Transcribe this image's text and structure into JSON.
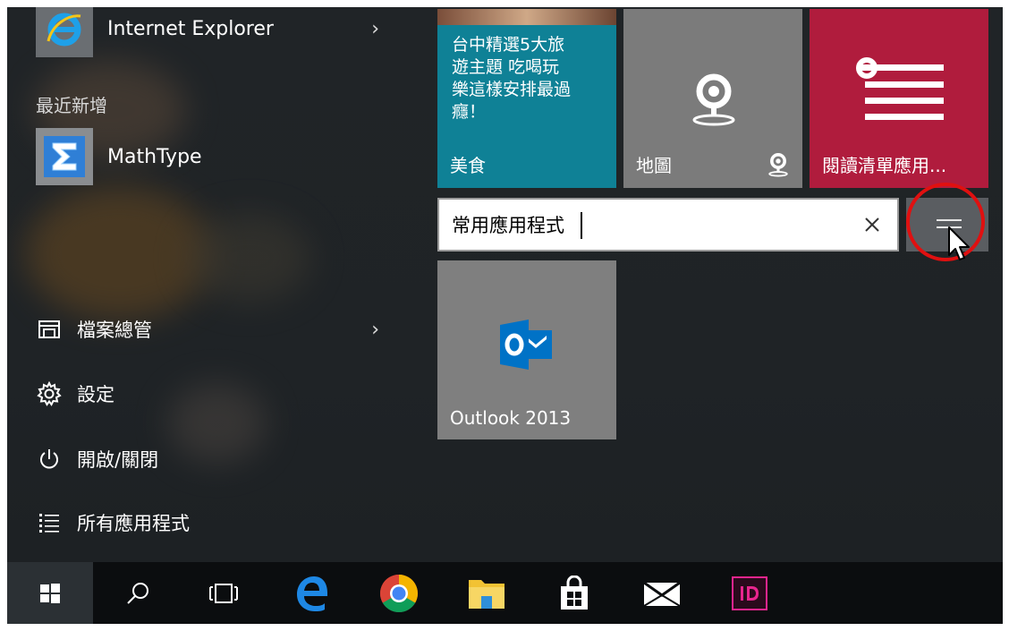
{
  "app_list": {
    "pinned_item": {
      "label": "Internet Explorer",
      "icon": "internet-explorer-icon"
    },
    "recently_added_header": "最近新增",
    "recent_item": {
      "label": "MathType",
      "icon": "mathtype-sigma-icon"
    }
  },
  "system_items": [
    {
      "label": "檔案總管",
      "icon": "file-explorer-icon"
    },
    {
      "label": "設定",
      "icon": "gear-icon"
    },
    {
      "label": "開啟/關閉",
      "icon": "power-icon"
    },
    {
      "label": "所有應用程式",
      "icon": "all-apps-list-icon"
    }
  ],
  "tiles": {
    "food": {
      "headline": "台中精選5大旅\n遊主題 吃喝玩\n樂這樣安排最過\n癮！",
      "label": "美食",
      "color": "#0f8196"
    },
    "maps": {
      "label": "地圖",
      "color": "#7b7b7b"
    },
    "reading_list": {
      "label": "閱讀清單應用...",
      "color": "#b01c3d"
    },
    "outlook": {
      "label": "Outlook 2013",
      "color": "#7f7f7f"
    }
  },
  "group_name": {
    "value": "常用應用程式"
  },
  "colors": {
    "highlight_ring": "#e01010",
    "outlook_blue": "#0072c6",
    "indesign_pink": "#e8258e"
  },
  "taskbar": {
    "items": [
      "windows-start-icon",
      "search-icon",
      "task-view-icon",
      "edge-icon",
      "chrome-icon",
      "file-explorer-icon",
      "store-icon",
      "mail-icon",
      "indesign-icon"
    ]
  }
}
